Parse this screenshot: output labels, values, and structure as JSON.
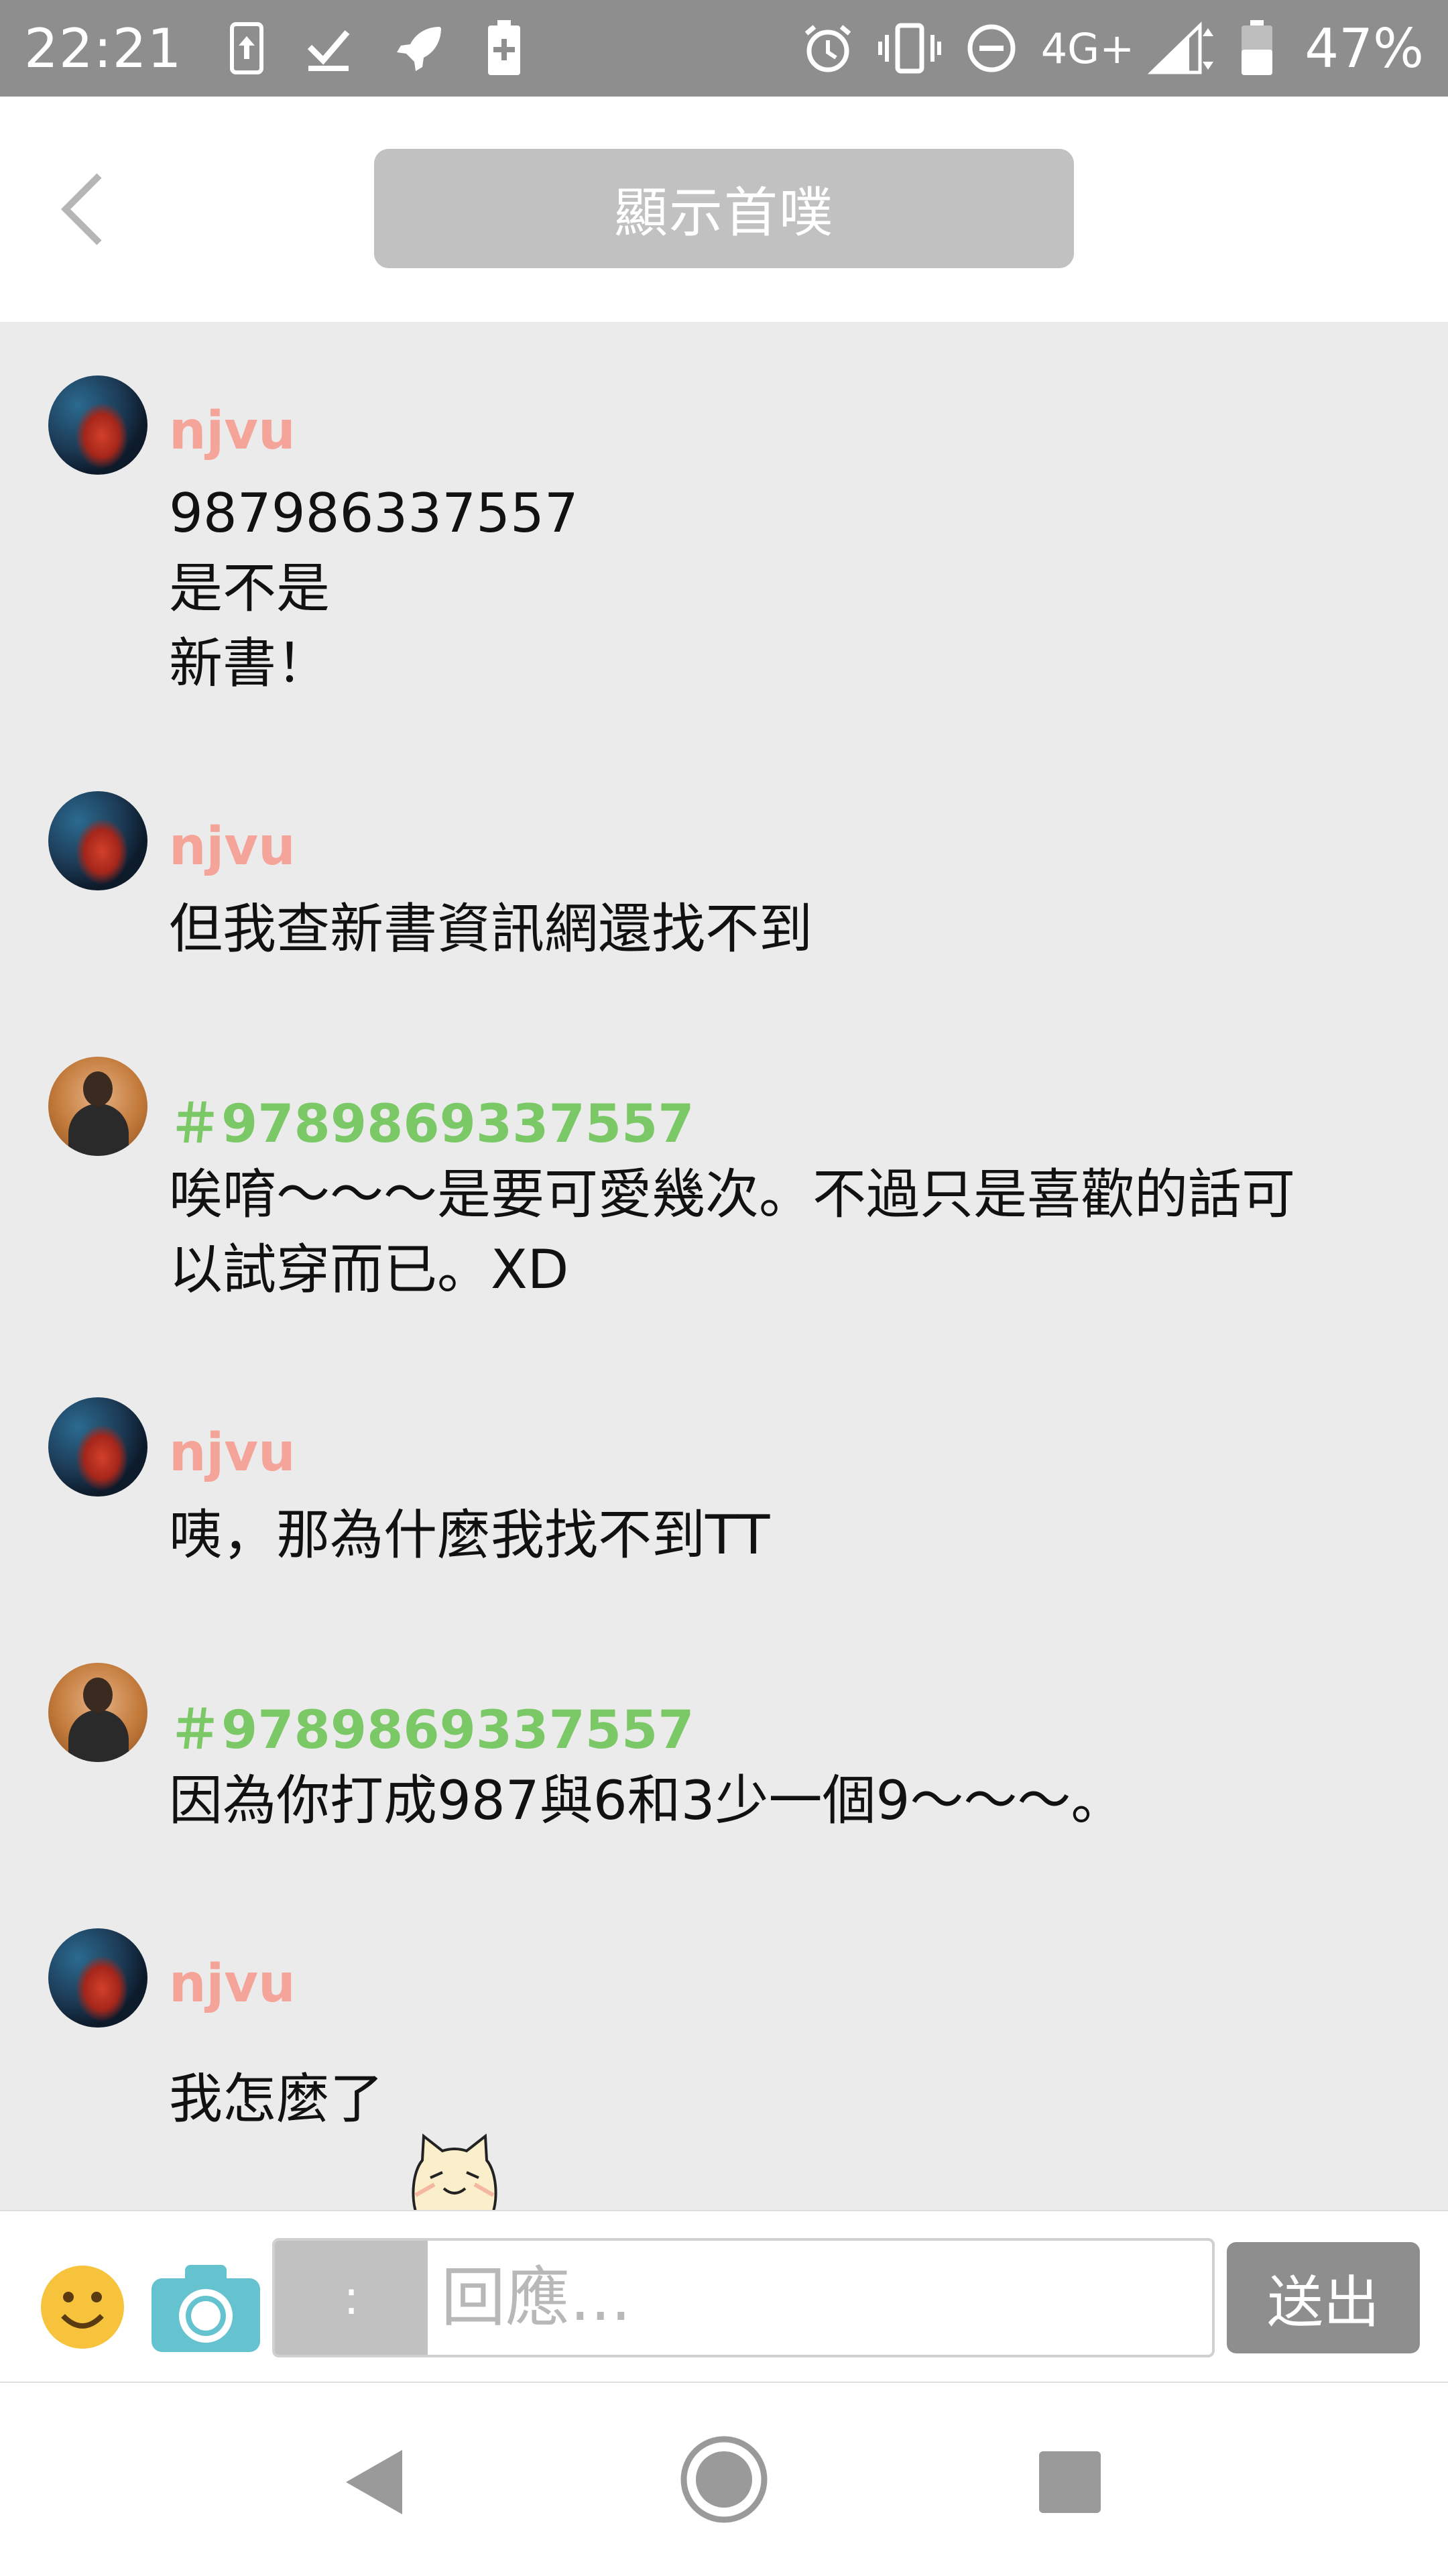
{
  "status_bar": {
    "time": "22:21",
    "network": "4G+",
    "battery_percent": "47%",
    "left_icons": [
      "upload-phone-icon",
      "download-check-icon",
      "rocket-icon",
      "battery-plus-icon"
    ],
    "right_icons": [
      "alarm-icon",
      "vibrate-icon",
      "do-not-disturb-icon",
      "signal-icon",
      "battery-icon"
    ]
  },
  "header": {
    "show_first_label": "顯示首噗"
  },
  "messages": [
    {
      "author": "njvu",
      "text": "987986337557\n是不是\n新書！"
    },
    {
      "author": "njvu",
      "text": "但我查新書資訊網還找不到"
    },
    {
      "author": "＃9789869337557",
      "text": "唉唷～～～是要可愛幾次。不過只是喜歡的話可\n以試穿而已。XD"
    },
    {
      "author": "njvu",
      "text": "咦，那為什麼我找不到TT"
    },
    {
      "author": "＃9789869337557",
      "text": "因為你打成987與6和3少一個9～～～。"
    },
    {
      "author": "njvu",
      "text": "我怎麼了"
    }
  ],
  "colors": {
    "author_a": "#f5a49a",
    "author_b": "#7bc867"
  },
  "reply_bar": {
    "qualifier": ":",
    "placeholder": "回應...",
    "send_label": "送出"
  }
}
